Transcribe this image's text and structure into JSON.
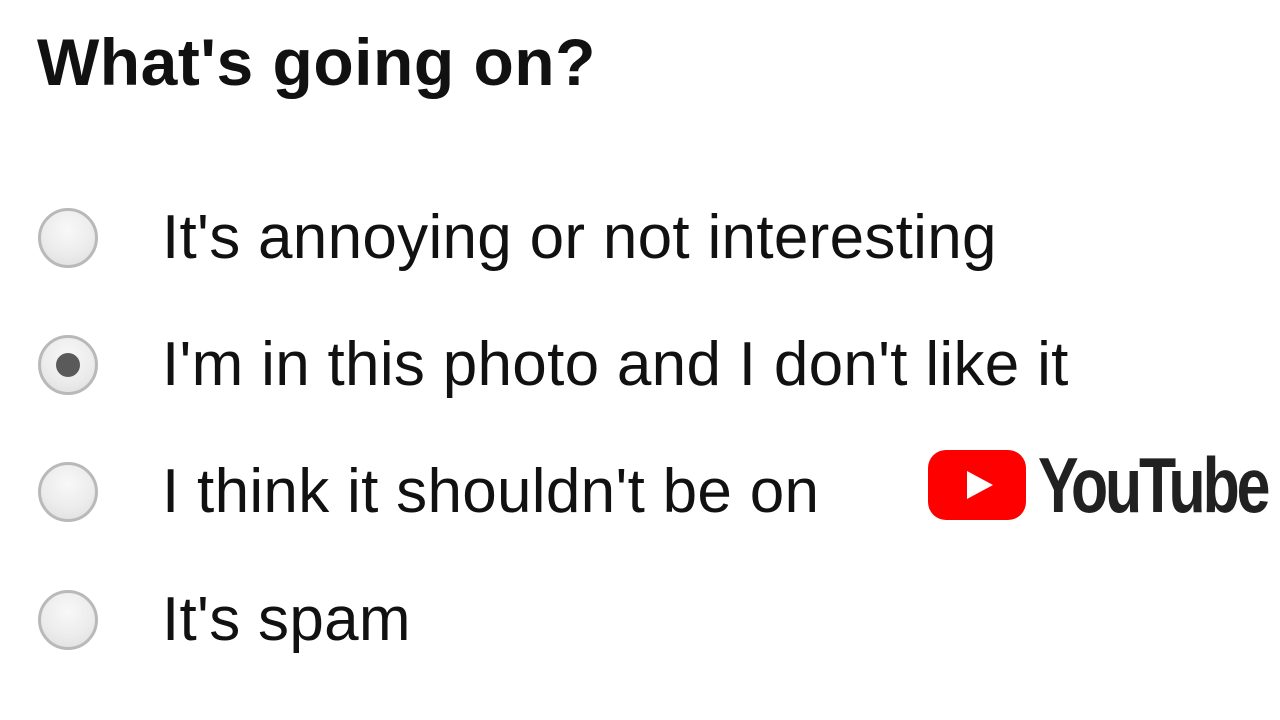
{
  "form": {
    "title": "What's going on?",
    "options": [
      {
        "label": "It's annoying or not interesting",
        "selected": false
      },
      {
        "label": "I'm in this photo and I don't like it",
        "selected": true
      },
      {
        "label": "I think it shouldn't be on",
        "selected": false
      },
      {
        "label": "It's spam",
        "selected": false
      }
    ]
  },
  "logo": {
    "wordmark": "YouTube",
    "icon": "play-icon",
    "color": "#ff0000"
  },
  "colors": {
    "text": "#111111",
    "radio_border": "#b9b9b9",
    "radio_dot": "#5a5a5a"
  }
}
